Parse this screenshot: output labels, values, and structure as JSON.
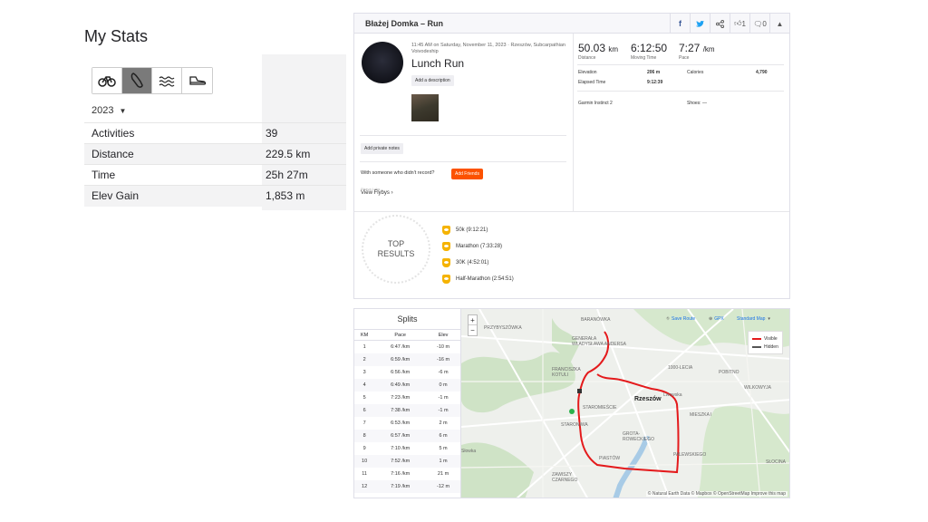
{
  "stats": {
    "title": "My Stats",
    "year": "2023",
    "rows": [
      {
        "label": "Activities",
        "value": "39"
      },
      {
        "label": "Distance",
        "value": "229.5 km"
      },
      {
        "label": "Time",
        "value": "25h 27m"
      },
      {
        "label": "Elev Gain",
        "value": "1,853 m"
      }
    ],
    "tabs": [
      "bike-icon",
      "shoe-icon",
      "swim-icon",
      "sneaker-icon"
    ]
  },
  "activity": {
    "header": "Błażej Domka – Run",
    "kudos": "1",
    "comments": "0",
    "meta": "11:45 AM on Saturday, November 11, 2023 · Rzeszów, Subcarpathian Voivodeship",
    "title": "Lunch Run",
    "add_description": "Add a description",
    "add_private_notes": "Add private notes",
    "friends_question": "With someone who didn't record?",
    "add_friends": "Add Friends",
    "flyby_label": "Strava Labs",
    "view_flybys": "View Flybys",
    "distance": "50.03",
    "distance_unit": "km",
    "distance_label": "Distance",
    "moving_time": "6:12:50",
    "moving_time_label": "Moving Time",
    "pace": "7:27",
    "pace_unit": "/km",
    "pace_label": "Pace",
    "elevation_label": "Elevation",
    "elevation": "206 m",
    "calories_label": "Calories",
    "calories": "4,790",
    "elapsed_label": "Elapsed Time",
    "elapsed": "9:12:39",
    "device": "Garmin Instinct 2",
    "shoes": "Shoes: —"
  },
  "top_results": {
    "badge": [
      "TOP",
      "RESULTS"
    ],
    "items": [
      {
        "name": "50k",
        "time": "(9:12:21)"
      },
      {
        "name": "Marathon",
        "time": "(7:33:28)"
      },
      {
        "name": "30K",
        "time": "(4:52:01)"
      },
      {
        "name": "Half-Marathon",
        "time": "(2:54:51)"
      }
    ]
  },
  "splits": {
    "title": "Splits",
    "headers": [
      "KM",
      "Pace",
      "Elev"
    ],
    "rows": [
      [
        "1",
        "6:47 /km",
        "-10 m"
      ],
      [
        "2",
        "6:59 /km",
        "-16 m"
      ],
      [
        "3",
        "6:56 /km",
        "-6 m"
      ],
      [
        "4",
        "6:49 /km",
        "0 m"
      ],
      [
        "5",
        "7:23 /km",
        "-1 m"
      ],
      [
        "6",
        "7:38 /km",
        "-1 m"
      ],
      [
        "7",
        "6:53 /km",
        "2 m"
      ],
      [
        "8",
        "6:57 /km",
        "6 m"
      ],
      [
        "9",
        "7:10 /km",
        "5 m"
      ],
      [
        "10",
        "7:52 /km",
        "1 m"
      ],
      [
        "11",
        "7:16 /km",
        "21 m"
      ],
      [
        "12",
        "7:19 /km",
        "-12 m"
      ]
    ]
  },
  "map": {
    "zoom_in": "+",
    "zoom_out": "−",
    "save_route": "Save Route",
    "gpx": "GPX",
    "map_type": "Standard Map",
    "legend_visible": "Visible",
    "legend_hidden": "Hidden",
    "attribution": "© Natural Earth Data © Mapbox © OpenStreetMap Improve this map",
    "city": "Rzeszów",
    "labels": [
      "BARANÓWKA",
      "GENERAŁA WŁADYSŁAWA ANDERSA",
      "PRZYBYSZÓWKA",
      "FRANCISZKA KOTULI",
      "1000-LECIA",
      "POBITNO",
      "WILKOWYJA",
      "STAROMIEŚCIE",
      "STARONIWA",
      "MIESZKA I",
      "GROTA-ROWECKIEGO",
      "PIASTÓW",
      "PALEWSKIEGO",
      "ZAWISZY CZARNEGO",
      "SŁOCINA",
      "Lwowska",
      "Słowka"
    ],
    "route_color": "#e41a1c"
  }
}
